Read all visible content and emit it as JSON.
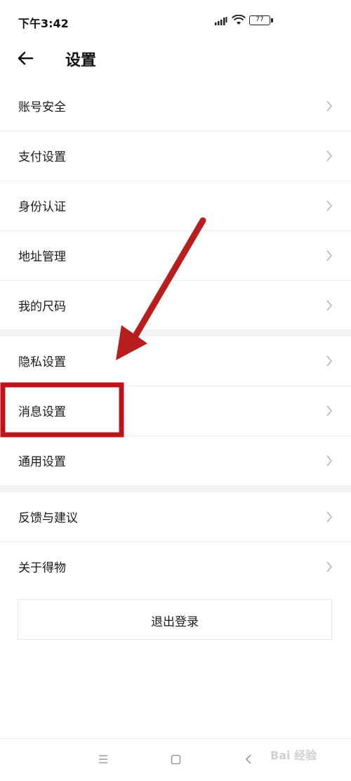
{
  "status_bar": {
    "time": "下午3:42",
    "battery_level": "77",
    "icons": [
      "signal-icon",
      "wifi-icon",
      "battery-icon"
    ]
  },
  "header": {
    "title": "设置",
    "back_icon": "arrow-left-icon"
  },
  "sections": [
    {
      "items": [
        {
          "label": "账号安全"
        },
        {
          "label": "支付设置"
        },
        {
          "label": "身份认证"
        },
        {
          "label": "地址管理"
        },
        {
          "label": "我的尺码"
        }
      ]
    },
    {
      "items": [
        {
          "label": "隐私设置"
        },
        {
          "label": "消息设置"
        },
        {
          "label": "通用设置"
        }
      ]
    },
    {
      "items": [
        {
          "label": "反馈与建议"
        },
        {
          "label": "关于得物"
        }
      ]
    }
  ],
  "logout": {
    "label": "退出登录"
  },
  "nav_bar": {
    "icons": [
      "menu-icon",
      "home-square-icon",
      "back-chevron-icon"
    ]
  },
  "watermark": {
    "text": "Bai 经验"
  },
  "annotation": {
    "highlight_color": "#c0121a",
    "arrow_color": "#b81e1e",
    "highlighted_item": "消息设置"
  }
}
